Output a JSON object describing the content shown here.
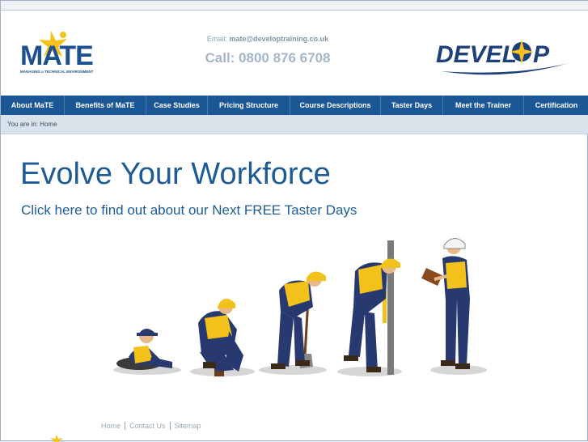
{
  "header": {
    "mate_logo": {
      "word": "MATE",
      "tagline": "MANAGING a TECHNICAL ENVIRONMENT"
    },
    "email_label": "Email:",
    "email": "mate@developtraining.co.uk",
    "phone": "Call: 0800 876 6708",
    "develop_logo": {
      "word": "DEVELOP"
    }
  },
  "nav": {
    "items": [
      {
        "label": "About MaTE"
      },
      {
        "label": "Benefits of MaTE"
      },
      {
        "label": "Case Studies"
      },
      {
        "label": "Pricing Structure"
      },
      {
        "label": "Course Descriptions"
      },
      {
        "label": "Taster Days"
      },
      {
        "label": "Meet the Trainer"
      },
      {
        "label": "Certification"
      }
    ]
  },
  "breadcrumb": {
    "text": "You are in: Home"
  },
  "main": {
    "title": "Evolve Your Workforce",
    "link": "Click here to find out about our Next FREE Taster Days"
  },
  "footer": {
    "links": [
      {
        "label": "Home"
      },
      {
        "label": "Contact Us"
      },
      {
        "label": "Sitemap"
      }
    ]
  },
  "colors": {
    "brand_blue": "#1a5794",
    "worker_blue": "#27396e",
    "vest_yellow": "#f2c21b",
    "helmet_white": "#f4f4f4"
  }
}
